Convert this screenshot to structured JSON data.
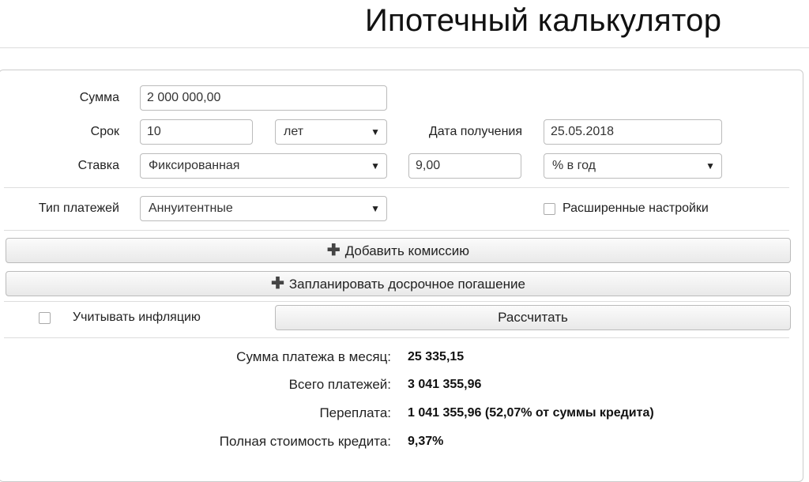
{
  "page": {
    "title": "Ипотечный калькулятор"
  },
  "form": {
    "amount_label": "Сумма",
    "amount_value": "2 000 000,00",
    "term_label": "Срок",
    "term_value": "10",
    "term_unit": "лет",
    "date_label": "Дата получения",
    "date_value": "25.05.2018",
    "rate_label": "Ставка",
    "rate_type": "Фиксированная",
    "rate_value": "9,00",
    "rate_unit": "% в год",
    "payment_type_label": "Тип платежей",
    "payment_type": "Аннуитентные",
    "advanced_label": "Расширенные настройки"
  },
  "buttons": {
    "add_commission": "Добавить комиссию",
    "plan_prepayment": "Запланировать досрочное погашение",
    "inflation_label": "Учитывать инфляцию",
    "calculate": "Рассчитать"
  },
  "results": {
    "monthly_label": "Сумма платежа в месяц:",
    "monthly_value": "25 335,15",
    "total_label": "Всего платежей:",
    "total_value": "3 041 355,96",
    "overpay_label": "Переплата:",
    "overpay_value": "1 041 355,96 (52,07% от суммы кредита)",
    "full_cost_label": "Полная стоимость кредита:",
    "full_cost_value": "9,37%"
  },
  "icons": {
    "dropdown": "caret-down-icon",
    "add": "plus-icon",
    "checkbox": "checkbox-icon"
  }
}
